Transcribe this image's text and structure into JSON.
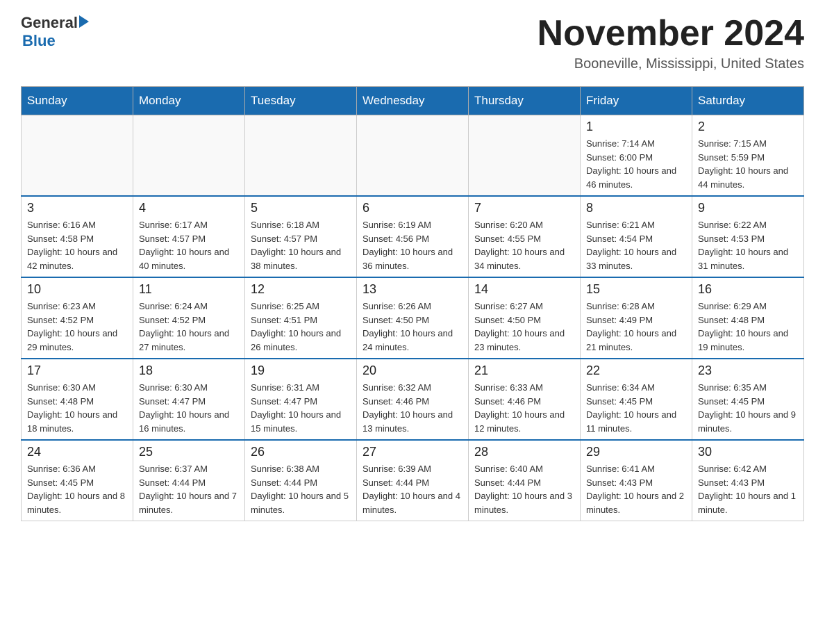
{
  "logo": {
    "general": "General",
    "blue": "Blue"
  },
  "header": {
    "month": "November 2024",
    "location": "Booneville, Mississippi, United States"
  },
  "days_of_week": [
    "Sunday",
    "Monday",
    "Tuesday",
    "Wednesday",
    "Thursday",
    "Friday",
    "Saturday"
  ],
  "weeks": [
    [
      {
        "day": "",
        "info": ""
      },
      {
        "day": "",
        "info": ""
      },
      {
        "day": "",
        "info": ""
      },
      {
        "day": "",
        "info": ""
      },
      {
        "day": "",
        "info": ""
      },
      {
        "day": "1",
        "info": "Sunrise: 7:14 AM\nSunset: 6:00 PM\nDaylight: 10 hours and 46 minutes."
      },
      {
        "day": "2",
        "info": "Sunrise: 7:15 AM\nSunset: 5:59 PM\nDaylight: 10 hours and 44 minutes."
      }
    ],
    [
      {
        "day": "3",
        "info": "Sunrise: 6:16 AM\nSunset: 4:58 PM\nDaylight: 10 hours and 42 minutes."
      },
      {
        "day": "4",
        "info": "Sunrise: 6:17 AM\nSunset: 4:57 PM\nDaylight: 10 hours and 40 minutes."
      },
      {
        "day": "5",
        "info": "Sunrise: 6:18 AM\nSunset: 4:57 PM\nDaylight: 10 hours and 38 minutes."
      },
      {
        "day": "6",
        "info": "Sunrise: 6:19 AM\nSunset: 4:56 PM\nDaylight: 10 hours and 36 minutes."
      },
      {
        "day": "7",
        "info": "Sunrise: 6:20 AM\nSunset: 4:55 PM\nDaylight: 10 hours and 34 minutes."
      },
      {
        "day": "8",
        "info": "Sunrise: 6:21 AM\nSunset: 4:54 PM\nDaylight: 10 hours and 33 minutes."
      },
      {
        "day": "9",
        "info": "Sunrise: 6:22 AM\nSunset: 4:53 PM\nDaylight: 10 hours and 31 minutes."
      }
    ],
    [
      {
        "day": "10",
        "info": "Sunrise: 6:23 AM\nSunset: 4:52 PM\nDaylight: 10 hours and 29 minutes."
      },
      {
        "day": "11",
        "info": "Sunrise: 6:24 AM\nSunset: 4:52 PM\nDaylight: 10 hours and 27 minutes."
      },
      {
        "day": "12",
        "info": "Sunrise: 6:25 AM\nSunset: 4:51 PM\nDaylight: 10 hours and 26 minutes."
      },
      {
        "day": "13",
        "info": "Sunrise: 6:26 AM\nSunset: 4:50 PM\nDaylight: 10 hours and 24 minutes."
      },
      {
        "day": "14",
        "info": "Sunrise: 6:27 AM\nSunset: 4:50 PM\nDaylight: 10 hours and 23 minutes."
      },
      {
        "day": "15",
        "info": "Sunrise: 6:28 AM\nSunset: 4:49 PM\nDaylight: 10 hours and 21 minutes."
      },
      {
        "day": "16",
        "info": "Sunrise: 6:29 AM\nSunset: 4:48 PM\nDaylight: 10 hours and 19 minutes."
      }
    ],
    [
      {
        "day": "17",
        "info": "Sunrise: 6:30 AM\nSunset: 4:48 PM\nDaylight: 10 hours and 18 minutes."
      },
      {
        "day": "18",
        "info": "Sunrise: 6:30 AM\nSunset: 4:47 PM\nDaylight: 10 hours and 16 minutes."
      },
      {
        "day": "19",
        "info": "Sunrise: 6:31 AM\nSunset: 4:47 PM\nDaylight: 10 hours and 15 minutes."
      },
      {
        "day": "20",
        "info": "Sunrise: 6:32 AM\nSunset: 4:46 PM\nDaylight: 10 hours and 13 minutes."
      },
      {
        "day": "21",
        "info": "Sunrise: 6:33 AM\nSunset: 4:46 PM\nDaylight: 10 hours and 12 minutes."
      },
      {
        "day": "22",
        "info": "Sunrise: 6:34 AM\nSunset: 4:45 PM\nDaylight: 10 hours and 11 minutes."
      },
      {
        "day": "23",
        "info": "Sunrise: 6:35 AM\nSunset: 4:45 PM\nDaylight: 10 hours and 9 minutes."
      }
    ],
    [
      {
        "day": "24",
        "info": "Sunrise: 6:36 AM\nSunset: 4:45 PM\nDaylight: 10 hours and 8 minutes."
      },
      {
        "day": "25",
        "info": "Sunrise: 6:37 AM\nSunset: 4:44 PM\nDaylight: 10 hours and 7 minutes."
      },
      {
        "day": "26",
        "info": "Sunrise: 6:38 AM\nSunset: 4:44 PM\nDaylight: 10 hours and 5 minutes."
      },
      {
        "day": "27",
        "info": "Sunrise: 6:39 AM\nSunset: 4:44 PM\nDaylight: 10 hours and 4 minutes."
      },
      {
        "day": "28",
        "info": "Sunrise: 6:40 AM\nSunset: 4:44 PM\nDaylight: 10 hours and 3 minutes."
      },
      {
        "day": "29",
        "info": "Sunrise: 6:41 AM\nSunset: 4:43 PM\nDaylight: 10 hours and 2 minutes."
      },
      {
        "day": "30",
        "info": "Sunrise: 6:42 AM\nSunset: 4:43 PM\nDaylight: 10 hours and 1 minute."
      }
    ]
  ]
}
